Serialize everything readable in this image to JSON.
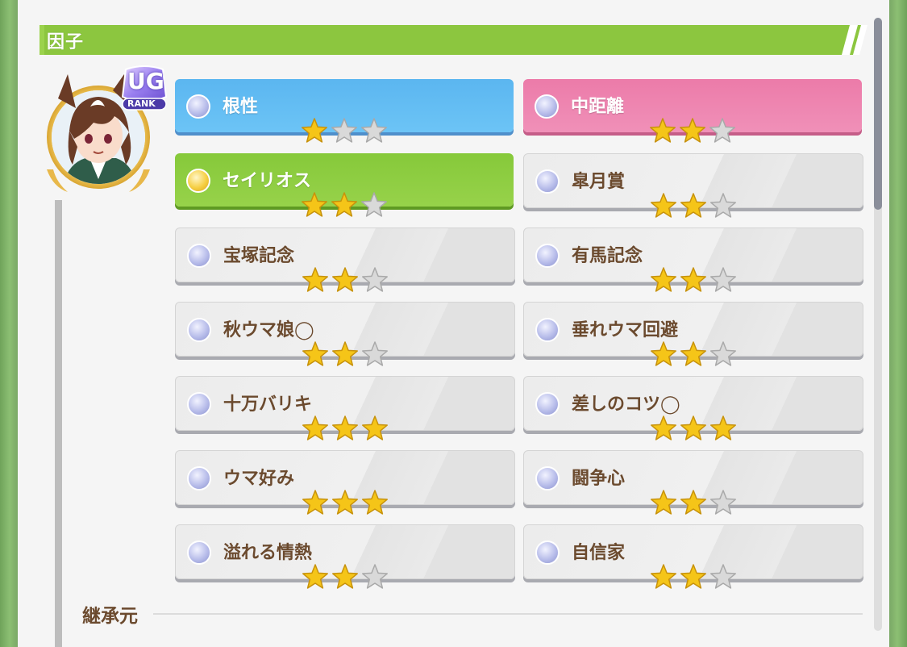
{
  "header": {
    "title": "因子"
  },
  "avatar": {
    "rank_badge": "UG",
    "rank_sub": "RANK"
  },
  "colors": {
    "blue": "#5bb6f0",
    "pink": "#ec7ba9",
    "green": "#86c93a",
    "star_on": "#f5c518",
    "star_off": "#d9d9d9",
    "text_brown": "#6b4a2e"
  },
  "factors": [
    {
      "label": "根性",
      "stars": 1,
      "max_stars": 3,
      "kind": "blue"
    },
    {
      "label": "中距離",
      "stars": 2,
      "max_stars": 3,
      "kind": "pink"
    },
    {
      "label": "セイリオス",
      "stars": 2,
      "max_stars": 3,
      "kind": "green"
    },
    {
      "label": "皐月賞",
      "stars": 2,
      "max_stars": 3,
      "kind": "gray"
    },
    {
      "label": "宝塚記念",
      "stars": 2,
      "max_stars": 3,
      "kind": "gray"
    },
    {
      "label": "有馬記念",
      "stars": 2,
      "max_stars": 3,
      "kind": "gray"
    },
    {
      "label": "秋ウマ娘◯",
      "stars": 2,
      "max_stars": 3,
      "kind": "gray"
    },
    {
      "label": "垂れウマ回避",
      "stars": 2,
      "max_stars": 3,
      "kind": "gray"
    },
    {
      "label": "十万バリキ",
      "stars": 3,
      "max_stars": 3,
      "kind": "gray"
    },
    {
      "label": "差しのコツ◯",
      "stars": 3,
      "max_stars": 3,
      "kind": "gray"
    },
    {
      "label": "ウマ好み",
      "stars": 3,
      "max_stars": 3,
      "kind": "gray"
    },
    {
      "label": "闘争心",
      "stars": 2,
      "max_stars": 3,
      "kind": "gray"
    },
    {
      "label": "溢れる情熱",
      "stars": 2,
      "max_stars": 3,
      "kind": "gray"
    },
    {
      "label": "自信家",
      "stars": 2,
      "max_stars": 3,
      "kind": "gray"
    }
  ],
  "footer": {
    "label": "継承元"
  }
}
